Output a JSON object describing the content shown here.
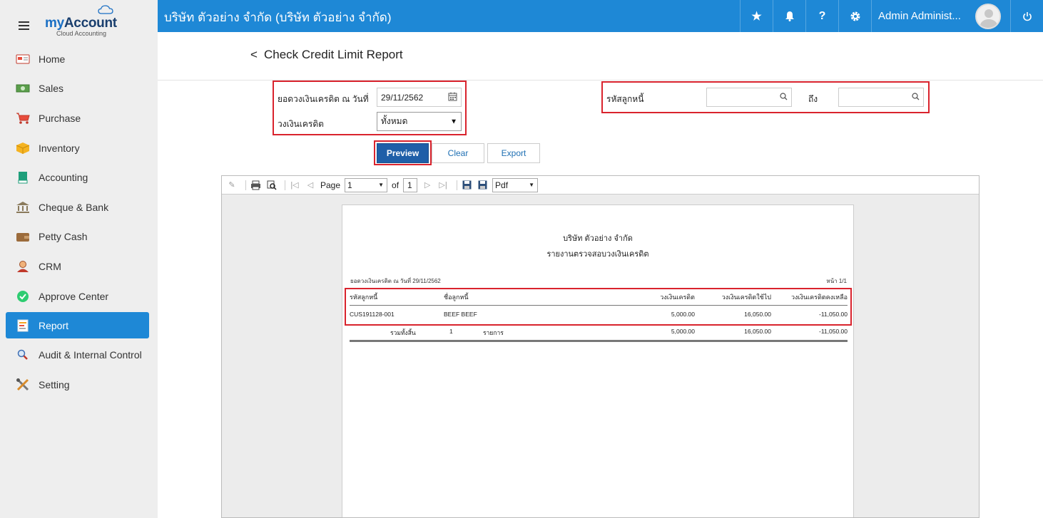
{
  "brand": {
    "name_prefix": "my",
    "name_main": "Account",
    "tagline": "Cloud Accounting"
  },
  "sidebar": {
    "items": [
      {
        "label": "Home",
        "icon": "home-icon",
        "active": false
      },
      {
        "label": "Sales",
        "icon": "money-icon",
        "active": false
      },
      {
        "label": "Purchase",
        "icon": "cart-icon",
        "active": false
      },
      {
        "label": "Inventory",
        "icon": "box-icon",
        "active": false
      },
      {
        "label": "Accounting",
        "icon": "book-icon",
        "active": false
      },
      {
        "label": "Cheque & Bank",
        "icon": "bank-icon",
        "active": false
      },
      {
        "label": "Petty Cash",
        "icon": "wallet-icon",
        "active": false
      },
      {
        "label": "CRM",
        "icon": "person-icon",
        "active": false
      },
      {
        "label": "Approve Center",
        "icon": "check-circle-icon",
        "active": false
      },
      {
        "label": "Report",
        "icon": "report-icon",
        "active": true
      },
      {
        "label": "Audit & Internal Control",
        "icon": "magnifier-icon",
        "active": false
      },
      {
        "label": "Setting",
        "icon": "tools-icon",
        "active": false
      }
    ]
  },
  "topbar": {
    "company": "บริษัท ตัวอย่าง จำกัด (บริษัท ตัวอย่าง จำกัด)",
    "user": "Admin Administ...",
    "accent": "#1e88d6"
  },
  "page": {
    "back": "<",
    "title": "Check Credit Limit Report"
  },
  "filters": {
    "credit_date_label": "ยอดวงเงินเครดิต ณ วันที่",
    "credit_date_value": "29/11/2562",
    "credit_limit_label": "วงเงินเครดิต",
    "credit_limit_value": "ทั้งหมด",
    "customer_code_label": "รหัสลูกหนี้",
    "to_label": "ถึง",
    "customer_from_value": "",
    "customer_to_value": ""
  },
  "buttons": {
    "preview": "Preview",
    "clear": "Clear",
    "export": "Export"
  },
  "viewer": {
    "page_label": "Page",
    "page_value": "1",
    "of_label": "of",
    "total_pages": "1",
    "format": "Pdf"
  },
  "report": {
    "company": "บริษัท ตัวอย่าง จำกัด",
    "title": "รายงานตรวจสอบวงเงินเครดิต",
    "as_of": "ยอดวงเงินเครดิต ณ วันที่ 29/11/2562",
    "page_no": "หน้า 1/1",
    "headers": [
      "รหัสลูกหนี้",
      "ชื่อลูกหนี้",
      "วงเงินเครดิต",
      "วงเงินเครดิตใช้ไป",
      "วงเงินเครดิตคงเหลือ"
    ],
    "rows": [
      {
        "code": "CUS191128-001",
        "name": "BEEF BEEF",
        "limit": "5,000.00",
        "used": "16,050.00",
        "remaining": "-11,050.00"
      }
    ],
    "total": {
      "label": "รวมทั้งสิ้น",
      "count": "1",
      "unit": "รายการ",
      "limit": "5,000.00",
      "used": "16,050.00",
      "remaining": "-11,050.00"
    }
  }
}
